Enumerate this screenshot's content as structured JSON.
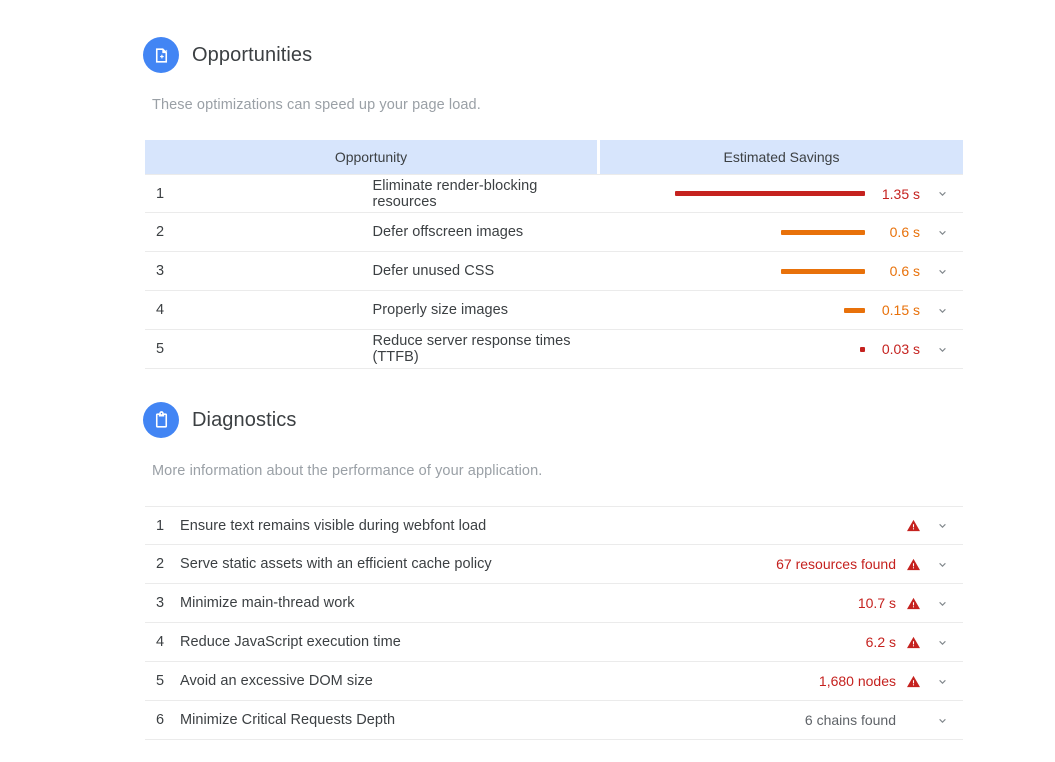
{
  "opportunities": {
    "icon": "page-add-icon",
    "title": "Opportunities",
    "description": "These optimizations can speed up your page load.",
    "columns": {
      "opportunity": "Opportunity",
      "savings": "Estimated Savings"
    },
    "max_seconds": 1.35,
    "rows": [
      {
        "index": "1",
        "title": "Eliminate render-blocking resources",
        "value": "1.35 s",
        "seconds": 1.35,
        "color": "#c5221f"
      },
      {
        "index": "2",
        "title": "Defer offscreen images",
        "value": "0.6 s",
        "seconds": 0.6,
        "color": "#e8710a"
      },
      {
        "index": "3",
        "title": "Defer unused CSS",
        "value": "0.6 s",
        "seconds": 0.6,
        "color": "#e8710a"
      },
      {
        "index": "4",
        "title": "Properly size images",
        "value": "0.15 s",
        "seconds": 0.15,
        "color": "#e8710a"
      },
      {
        "index": "5",
        "title": "Reduce server response times (TTFB)",
        "value": "0.03 s",
        "seconds": 0.03,
        "color": "#c5221f"
      }
    ]
  },
  "diagnostics": {
    "icon": "clipboard-icon",
    "title": "Diagnostics",
    "description": "More information about the performance of your application.",
    "rows": [
      {
        "index": "1",
        "title": "Ensure text remains visible during webfont load",
        "value": "",
        "warning": true,
        "color": "#c5221f"
      },
      {
        "index": "2",
        "title": "Serve static assets with an efficient cache policy",
        "value": "67 resources found",
        "warning": true,
        "color": "#c5221f"
      },
      {
        "index": "3",
        "title": "Minimize main-thread work",
        "value": "10.7 s",
        "warning": true,
        "color": "#c5221f"
      },
      {
        "index": "4",
        "title": "Reduce JavaScript execution time",
        "value": "6.2 s",
        "warning": true,
        "color": "#c5221f"
      },
      {
        "index": "5",
        "title": "Avoid an excessive DOM size",
        "value": "1,680 nodes",
        "warning": true,
        "color": "#c5221f"
      },
      {
        "index": "6",
        "title": "Minimize Critical Requests Depth",
        "value": "6 chains found",
        "warning": false,
        "color": "#5f6368"
      }
    ]
  },
  "theme": {
    "accent": "#4285f4",
    "header_bg": "#d7e5fc",
    "text": "#3c4043",
    "muted": "#9aa0a6",
    "red": "#c5221f",
    "orange": "#e8710a"
  }
}
